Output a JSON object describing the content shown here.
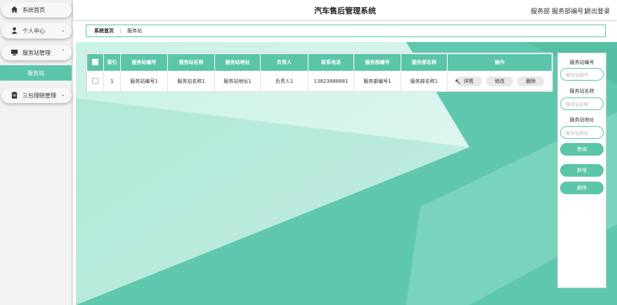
{
  "app": {
    "title": "汽车售后管理系统",
    "user": "服务部 服务部编号1",
    "logout": "退出登录"
  },
  "sidebar": {
    "items": [
      {
        "label": "系统首页",
        "icon": "home-icon"
      },
      {
        "label": "个人中心",
        "icon": "user-icon"
      },
      {
        "label": "服务站管理",
        "icon": "monitor-icon"
      },
      {
        "label": "三包理赔管理",
        "icon": "clipboard-icon"
      }
    ],
    "active_sub": "服务站"
  },
  "breadcrumb": {
    "home": "系统首页",
    "current": "服务站"
  },
  "table": {
    "headers": [
      "索引",
      "服务站编号",
      "服务站名称",
      "服务站地址",
      "负责人",
      "联系电话",
      "服务部编号",
      "服务部名称",
      "操作"
    ],
    "rows": [
      {
        "index": "1",
        "code": "服务站编号1",
        "name": "服务站名称1",
        "address": "服务站地址1",
        "manager": "负责人1",
        "phone": "13823888881",
        "dept_code": "服务部编号1",
        "dept_name": "服务部名称1"
      }
    ],
    "actions": {
      "detail": "详情",
      "edit": "修改",
      "delete": "删除"
    }
  },
  "search_panel": {
    "fields": [
      {
        "label": "服务站编号",
        "placeholder": "服务站编号"
      },
      {
        "label": "服务站名称",
        "placeholder": "服务站名称"
      },
      {
        "label": "服务站地址",
        "placeholder": "服务站地址"
      }
    ],
    "query": "查询",
    "add": "新增",
    "delete": "删除"
  },
  "colors": {
    "accent": "#5bc5aa",
    "bg_light": "#c6efe3"
  }
}
